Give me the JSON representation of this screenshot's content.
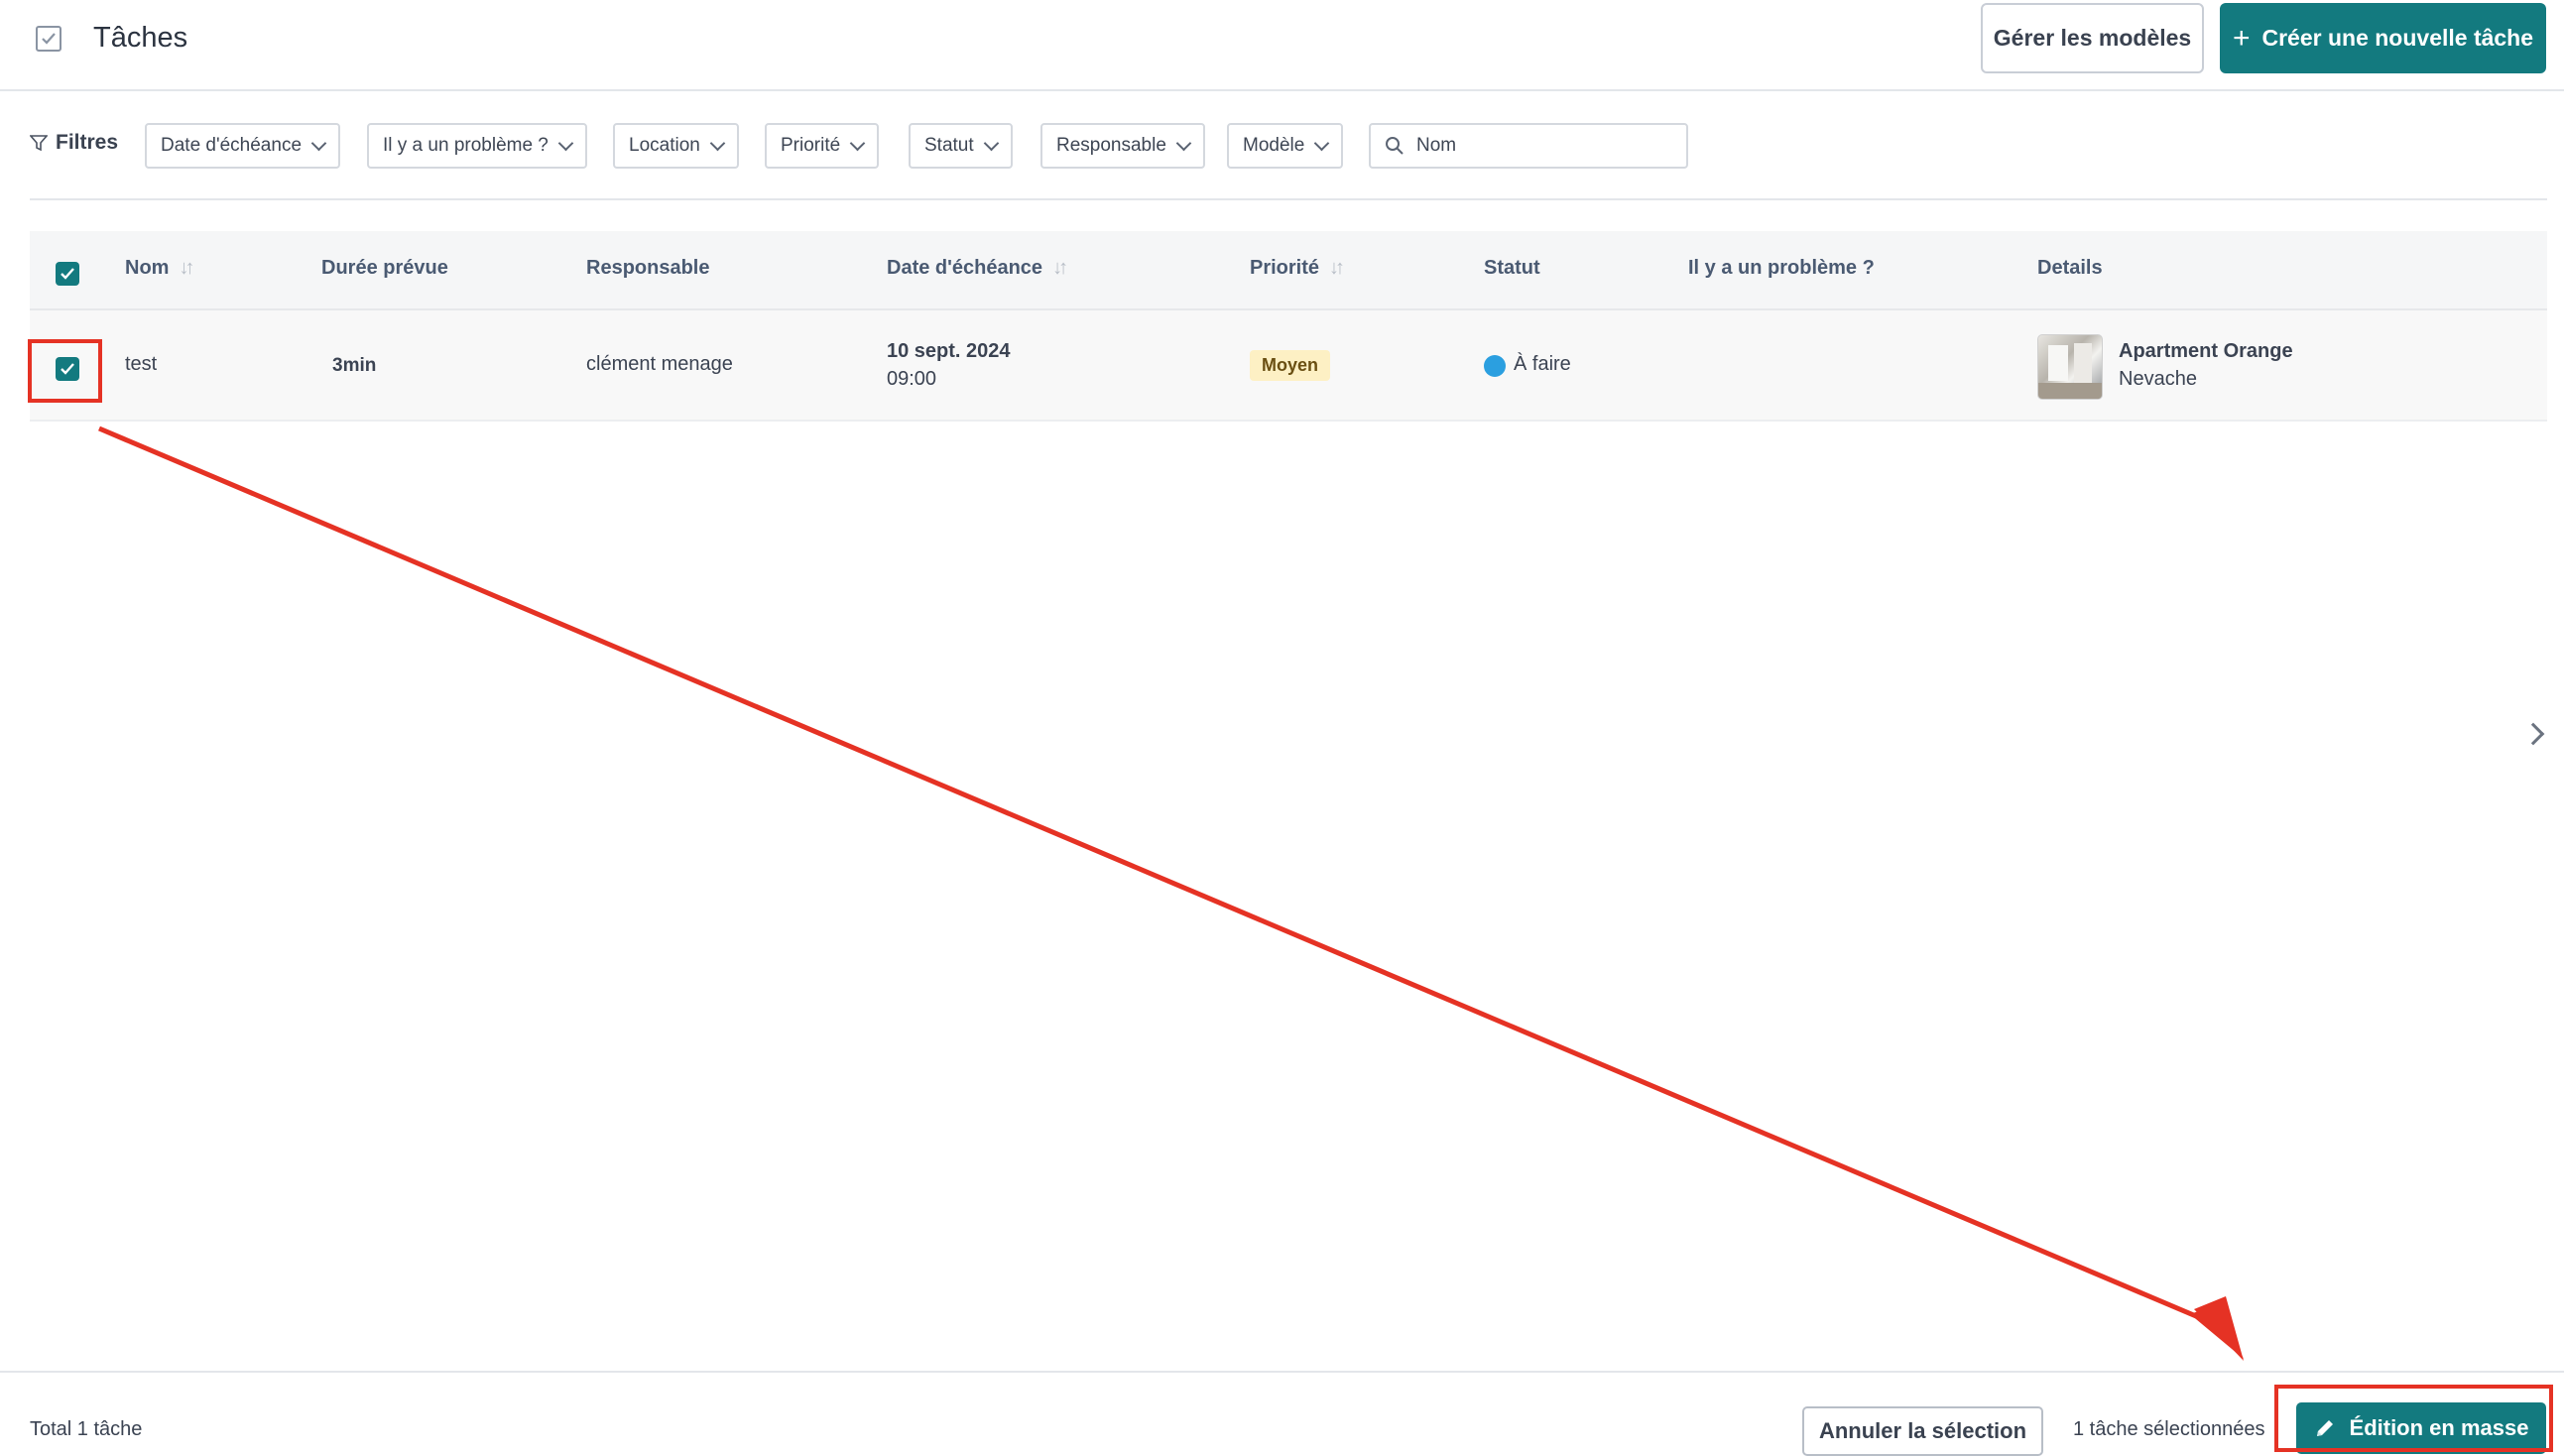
{
  "header": {
    "title": "Tâches",
    "title_icon": "checkbox-icon",
    "manage_templates_label": "Gérer les modèles",
    "create_task_label": "Créer une nouvelle tâche"
  },
  "filters": {
    "label": "Filtres",
    "chips": [
      "Date d'échéance",
      "Il y a un problème ?",
      "Location",
      "Priorité",
      "Statut",
      "Responsable",
      "Modèle"
    ],
    "search_placeholder": "Nom"
  },
  "table": {
    "columns": [
      "Nom",
      "Durée prévue",
      "Responsable",
      "Date d'échéance",
      "Priorité",
      "Statut",
      "Il y a un problème ?",
      "Details"
    ],
    "rows": [
      {
        "name": "test",
        "duration": "3min",
        "assignee": "clément menage",
        "due_date": "10 sept. 2024",
        "due_time": "09:00",
        "priority": "Moyen",
        "status": "À faire",
        "problem": "",
        "details_title": "Apartment Orange",
        "details_subtitle": "Nevache",
        "selected": true
      }
    ]
  },
  "footer": {
    "total": "Total 1 tâche",
    "cancel_selection_label": "Annuler la sélection",
    "selected_count": "1 tâche sélectionnées",
    "bulk_edit_label": "Édition en masse"
  },
  "colors": {
    "accent": "#137a7f",
    "annotation": "#e53224",
    "status_todo": "#2b9fe0",
    "priority_medium_bg": "#fdf0c4"
  }
}
